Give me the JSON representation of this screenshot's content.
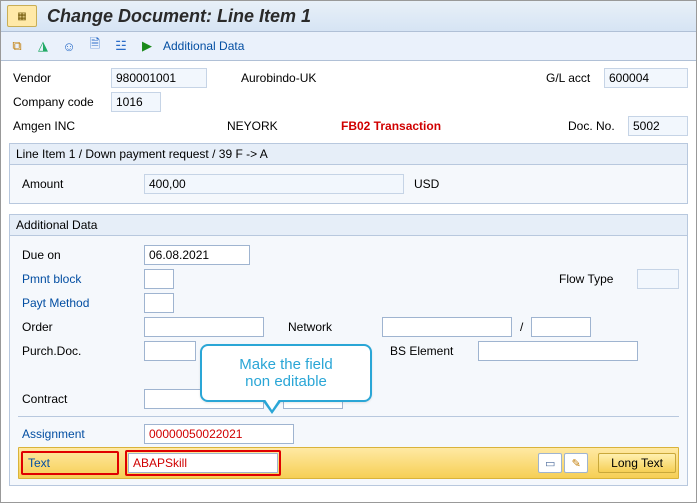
{
  "title": "Change Document: Line Item 1",
  "toolbar": {
    "additional_data": "Additional Data"
  },
  "header": {
    "vendor_lbl": "Vendor",
    "vendor_val": "980001001",
    "vendor_name": "Aurobindo-UK",
    "gl_lbl": "G/L acct",
    "gl_val": "600004",
    "cc_lbl": "Company code",
    "cc_val": "1016",
    "company_name": "Amgen INC",
    "city": "NEYORK",
    "annotation": "FB02 Transaction",
    "docno_lbl": "Doc. No.",
    "docno_val": "5002"
  },
  "line_section": {
    "title": "Line Item 1 / Down payment request / 39 F -> A",
    "amount_lbl": "Amount",
    "amount_val": "400,00",
    "currency": "USD"
  },
  "add_section": {
    "title": "Additional Data",
    "dueon_lbl": "Due on",
    "dueon_val": "06.08.2021",
    "pmntblock_lbl": "Pmnt block",
    "flowtype_lbl": "Flow Type",
    "paytmethod_lbl": "Payt Method",
    "order_lbl": "Order",
    "network_lbl": "Network",
    "slash": "/",
    "purchdoc_lbl": "Purch.Doc.",
    "wbs_lbl": "BS Element",
    "contract_lbl": "Contract",
    "assign_lbl": "Assignment",
    "assign_val": "00000050022021",
    "text_lbl": "Text",
    "text_val": "ABAPSkill",
    "longtext_lbl": "Long Text"
  },
  "callout": {
    "line1": "Make the field",
    "line2": "non editable"
  }
}
